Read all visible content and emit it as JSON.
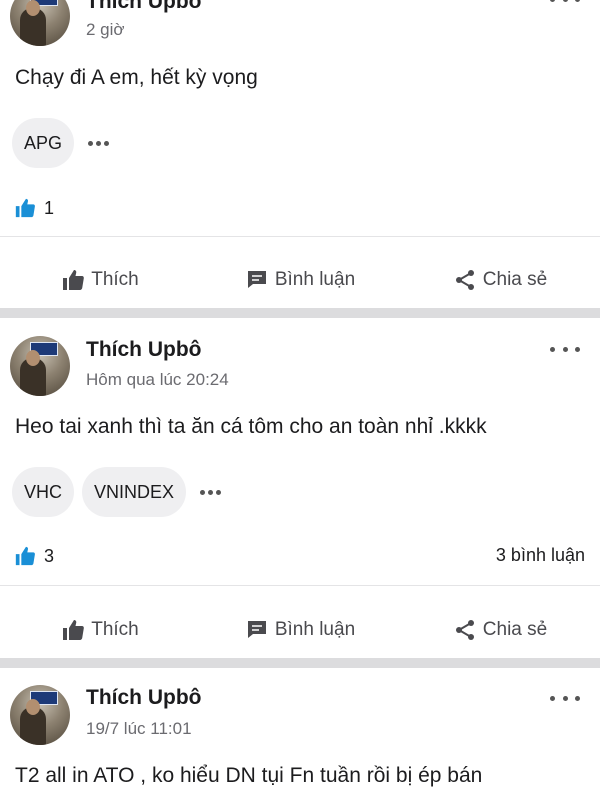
{
  "posts": [
    {
      "author": "Thích Upbô",
      "time": "2 giờ",
      "content": "Chạy đi A em, hết kỳ vọng",
      "tags": [
        "APG"
      ],
      "likes": "1",
      "comments": ""
    },
    {
      "author": "Thích Upbô",
      "time": "Hôm qua lúc 20:24",
      "content": "Heo tai xanh thì ta ăn cá tôm cho an toàn nhỉ .kkkk",
      "tags": [
        "VHC",
        "VNINDEX"
      ],
      "likes": "3",
      "comments": "3 bình luận"
    },
    {
      "author": "Thích Upbô",
      "time": "19/7 lúc 11:01",
      "content": "T2 all in ATO , ko hiểu DN tụi Fn tuần rồi bị ép bán"
    }
  ],
  "actions": {
    "like": "Thích",
    "comment": "Bình luận",
    "share": "Chia sẻ"
  },
  "colors": {
    "like_icon": "#1a8fd6",
    "action_icon": "#4a4a4e",
    "separator": "#dcdcde"
  }
}
